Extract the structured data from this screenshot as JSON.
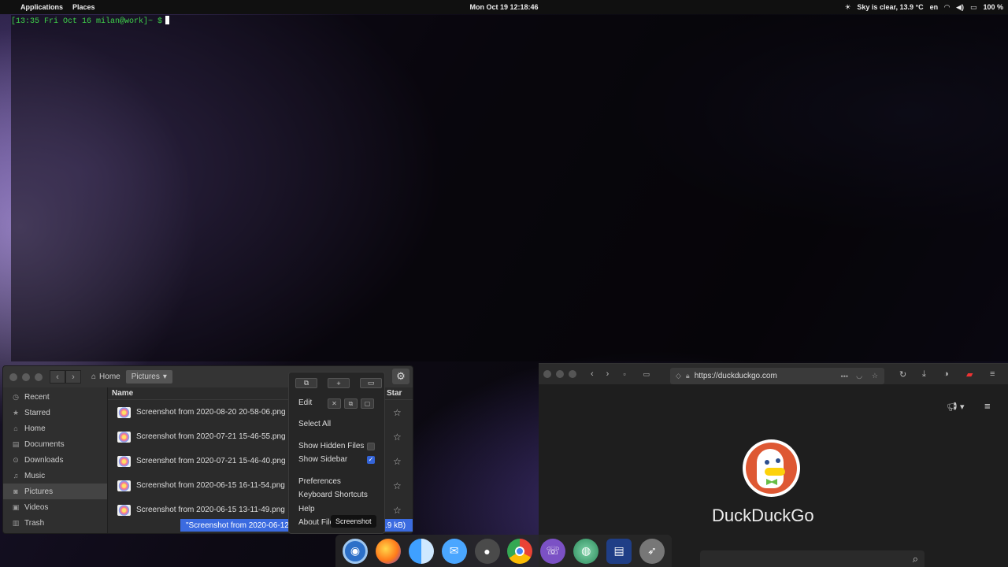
{
  "topbar": {
    "menu": [
      "Applications",
      "Places"
    ],
    "clock": "Mon Oct 19  12:18:46",
    "weather": "Sky is clear, 13.9 °C",
    "lang": "en",
    "battery": "100 %"
  },
  "terminal": {
    "prompt": "[13:35 Fri Oct 16 milan@work]~ $"
  },
  "file_manager": {
    "breadcrumb": [
      "Home",
      "Pictures"
    ],
    "sidebar": [
      {
        "label": "Recent",
        "icon": "clock-icon"
      },
      {
        "label": "Starred",
        "icon": "star-icon"
      },
      {
        "label": "Home",
        "icon": "home-icon"
      },
      {
        "label": "Documents",
        "icon": "document-icon"
      },
      {
        "label": "Downloads",
        "icon": "download-icon"
      },
      {
        "label": "Music",
        "icon": "music-icon"
      },
      {
        "label": "Pictures",
        "icon": "camera-icon"
      },
      {
        "label": "Videos",
        "icon": "video-icon"
      },
      {
        "label": "Trash",
        "icon": "trash-icon"
      }
    ],
    "selected_sidebar": "Pictures",
    "columns": {
      "name": "Name",
      "star": "Star"
    },
    "files": [
      "Screenshot from 2020-08-20 20-58-06.png",
      "Screenshot from 2020-07-21 15-46-55.png",
      "Screenshot from 2020-07-21 15-46-40.png",
      "Screenshot from 2020-06-15 16-11-54.png",
      "Screenshot from 2020-06-15 13-11-49.png"
    ],
    "status_prefix": "\"Screenshot from 2020-06-12",
    "status_suffix": ".9 kB)"
  },
  "menu_popover": {
    "edit": "Edit",
    "select_all": "Select All",
    "show_hidden": "Show Hidden Files",
    "show_sidebar": "Show Sidebar",
    "preferences": "Preferences",
    "shortcuts": "Keyboard Shortcuts",
    "help": "Help",
    "about": "About Files",
    "show_hidden_checked": false,
    "show_sidebar_checked": true
  },
  "tooltip": "Screenshot",
  "browser": {
    "url": "https://duckduckgo.com",
    "brand": "DuckDuckGo"
  },
  "dock": [
    {
      "name": "screenshot-app-icon",
      "color": "#3c7fd8"
    },
    {
      "name": "firefox-icon",
      "color": "#ff7a1a"
    },
    {
      "name": "finder-icon",
      "color": "#3fa0ff"
    },
    {
      "name": "mail-icon",
      "color": "#4aa6ff"
    },
    {
      "name": "ink-icon",
      "color": "#555555"
    },
    {
      "name": "chrome-icon",
      "color": "#4caf50"
    },
    {
      "name": "viber-icon",
      "color": "#7b51c5"
    },
    {
      "name": "world-icon",
      "color": "#3ba56b"
    },
    {
      "name": "mockup-icon",
      "color": "#2f5bb5"
    },
    {
      "name": "rocket-icon",
      "color": "#8a8a8a"
    }
  ]
}
